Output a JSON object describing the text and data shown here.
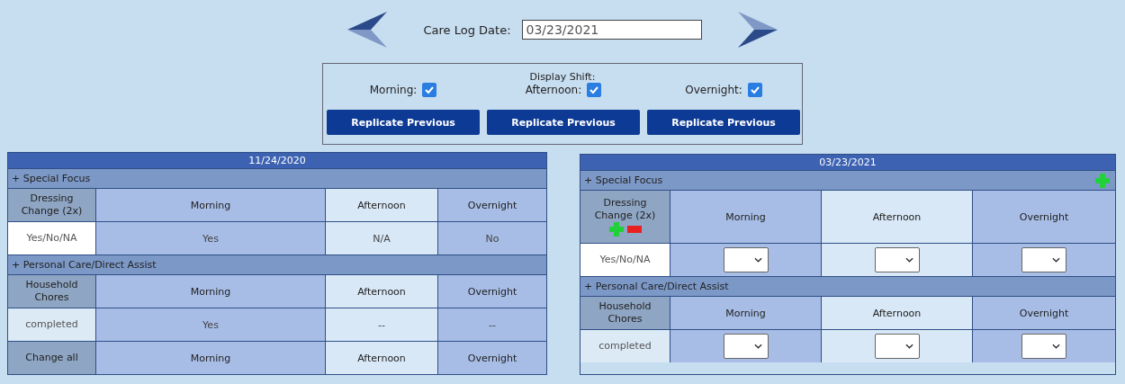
{
  "header": {
    "date_label": "Care Log Date:",
    "date_value": "03/23/2021"
  },
  "display_shift": {
    "title": "Display Shift:",
    "shifts": [
      {
        "label": "Morning:",
        "checked": true,
        "button": "Replicate Previous"
      },
      {
        "label": "Afternoon:",
        "checked": true,
        "button": "Replicate Previous"
      },
      {
        "label": "Overnight:",
        "checked": true,
        "button": "Replicate Previous"
      }
    ]
  },
  "logs": [
    {
      "date": "11/24/2020",
      "kind": "readonly",
      "sections": [
        {
          "title": "+ Special Focus",
          "items": [
            {
              "label": "Dressing Change (2x)",
              "columns": [
                "Morning",
                "Afternoon",
                "Overnight"
              ],
              "value_label": "Yes/No/NA",
              "values": [
                "Yes",
                "N/A",
                "No"
              ]
            }
          ]
        },
        {
          "title": "+ Personal Care/Direct Assist",
          "items": [
            {
              "label": "Household Chores",
              "columns": [
                "Morning",
                "Afternoon",
                "Overnight"
              ],
              "value_label": "completed",
              "values": [
                "Yes",
                "--",
                "--"
              ]
            },
            {
              "label": "Change all",
              "columns": [
                "Morning",
                "Afternoon",
                "Overnight"
              ]
            }
          ]
        }
      ]
    },
    {
      "date": "03/23/2021",
      "kind": "editable",
      "sections": [
        {
          "title": "+ Special Focus",
          "items": [
            {
              "label": "Dressing Change (2x)",
              "columns": [
                "Morning",
                "Afternoon",
                "Overnight"
              ],
              "value_label": "Yes/No/NA",
              "kind": "dropdown"
            }
          ]
        },
        {
          "title": "+ Personal Care/Direct Assist",
          "items": [
            {
              "label": "Household Chores",
              "columns": [
                "Morning",
                "Afternoon",
                "Overnight"
              ],
              "value_label": "completed",
              "kind": "dropdown"
            }
          ]
        }
      ]
    }
  ]
}
